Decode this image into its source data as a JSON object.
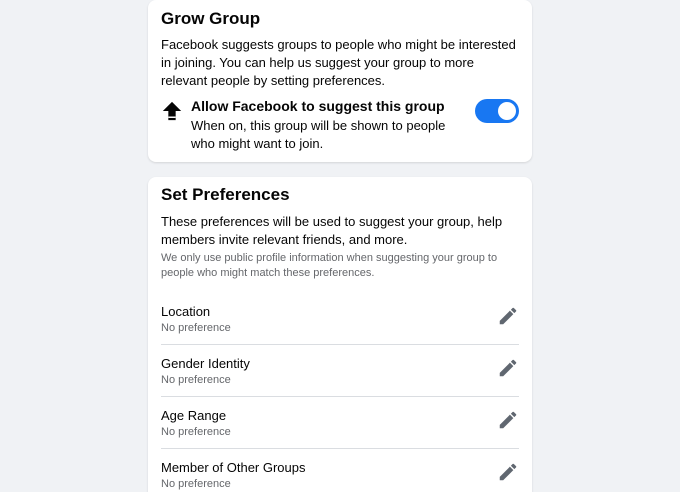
{
  "grow_group": {
    "title": "Grow Group",
    "description": "Facebook suggests groups to people who might be interested in joining. You can help us suggest your group to more relevant people by setting preferences.",
    "toggle": {
      "icon": "arrow-up-icon",
      "title": "Allow Facebook to suggest this group",
      "description": "When on, this group will be shown to people who might want to join.",
      "enabled": true
    }
  },
  "set_preferences": {
    "title": "Set Preferences",
    "description": "These preferences will be used to suggest your group, help members invite relevant friends, and more.",
    "note": "We only use public profile information when suggesting your group to people who might match these preferences.",
    "items": [
      {
        "label": "Location",
        "value": "No preference",
        "icon": "pencil-icon"
      },
      {
        "label": "Gender Identity",
        "value": "No preference",
        "icon": "pencil-icon"
      },
      {
        "label": "Age Range",
        "value": "No preference",
        "icon": "pencil-icon"
      },
      {
        "label": "Member of Other Groups",
        "value": "No preference",
        "icon": "pencil-icon"
      }
    ]
  },
  "colors": {
    "background": "#f0f2f5",
    "card": "#ffffff",
    "accent": "#1877f2",
    "secondary_text": "#65676b",
    "icon": "#606770"
  }
}
